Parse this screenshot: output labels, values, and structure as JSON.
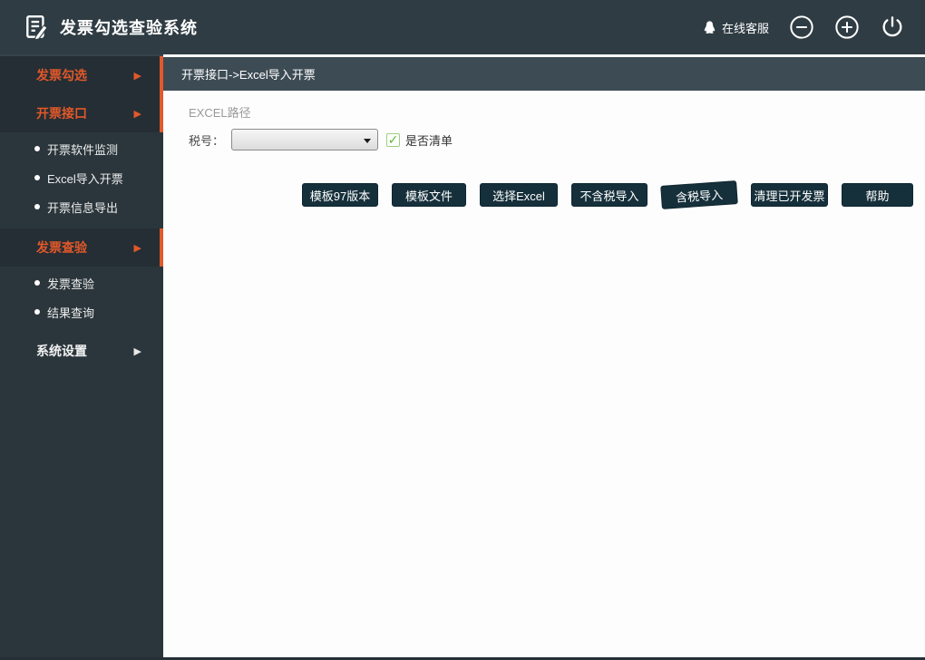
{
  "app": {
    "title": "发票勾选查验系统",
    "online_service_label": "在线客服"
  },
  "header_icons": {
    "minimize_glyph": "−",
    "add_glyph": "+"
  },
  "sidebar": {
    "items": [
      {
        "label": "发票勾选",
        "type": "group",
        "highlighted": true
      },
      {
        "label": "开票接口",
        "type": "group",
        "highlighted": true
      },
      {
        "label": "开票软件监测",
        "type": "sub"
      },
      {
        "label": "Excel导入开票",
        "type": "sub"
      },
      {
        "label": "开票信息导出",
        "type": "sub"
      },
      {
        "label": "发票查验",
        "type": "group",
        "highlighted": true
      },
      {
        "label": "发票查验",
        "type": "sub"
      },
      {
        "label": "结果查询",
        "type": "sub"
      },
      {
        "label": "系统设置",
        "type": "group",
        "highlighted": false
      }
    ],
    "arrow_glyph": "▶"
  },
  "breadcrumb": {
    "text": "开票接口->Excel导入开票"
  },
  "form": {
    "path_label": "EXCEL路径",
    "tax_number_label": "税号：",
    "tax_number_value": "",
    "is_list_label": "是否清单",
    "is_list_checked": true,
    "check_glyph": "✓"
  },
  "buttons": [
    "模板97版本",
    "模板文件",
    "选择Excel",
    "不含税导入",
    "含税导入",
    "清理已开发票",
    "帮助"
  ],
  "colors": {
    "accent_orange": "#e2582a",
    "header_bg": "#2f3c43",
    "sidebar_bg": "#2b363c",
    "group_row_bg": "#242e34",
    "breadcrumb_bg": "#3d4b54",
    "button_bg": "#16303b",
    "check_green": "#5cb832"
  }
}
